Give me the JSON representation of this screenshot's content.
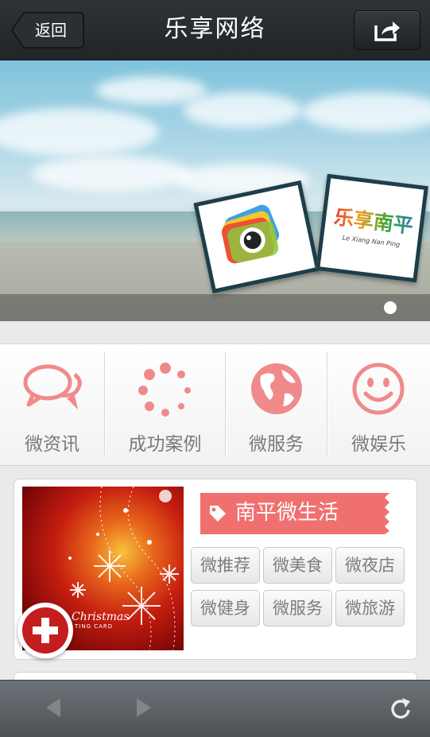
{
  "header": {
    "back_label": "返回",
    "title": "乐享网络",
    "share_icon": "share-icon"
  },
  "banner": {
    "logo_right_text": "乐享南平",
    "logo_right_subtext": "Le Xiang Nan Ping",
    "slide_count": 1,
    "active_slide": 1
  },
  "menu": {
    "items": [
      {
        "label": "微资讯",
        "icon": "chat-bubbles-icon"
      },
      {
        "label": "成功案例",
        "icon": "loading-dots-icon"
      },
      {
        "label": "微服务",
        "icon": "globe-icon"
      },
      {
        "label": "微娱乐",
        "icon": "smiley-icon"
      }
    ],
    "icon_color": "#f08a8a"
  },
  "feature": {
    "ribbon_label": "南平微生活",
    "ribbon_color": "#f07070",
    "tags": [
      "微推荐",
      "微美食",
      "微夜店",
      "微健身",
      "微服务",
      "微旅游"
    ],
    "photo_caption": "Christmas",
    "photo_caption2": "TING CARD"
  },
  "bottom_nav": {
    "back_icon": "back-arrow-icon",
    "forward_icon": "forward-arrow-icon",
    "refresh_icon": "refresh-icon"
  },
  "colors": {
    "topbar": "#26292c",
    "accent": "#f07070",
    "fab": "#c41d1f"
  }
}
